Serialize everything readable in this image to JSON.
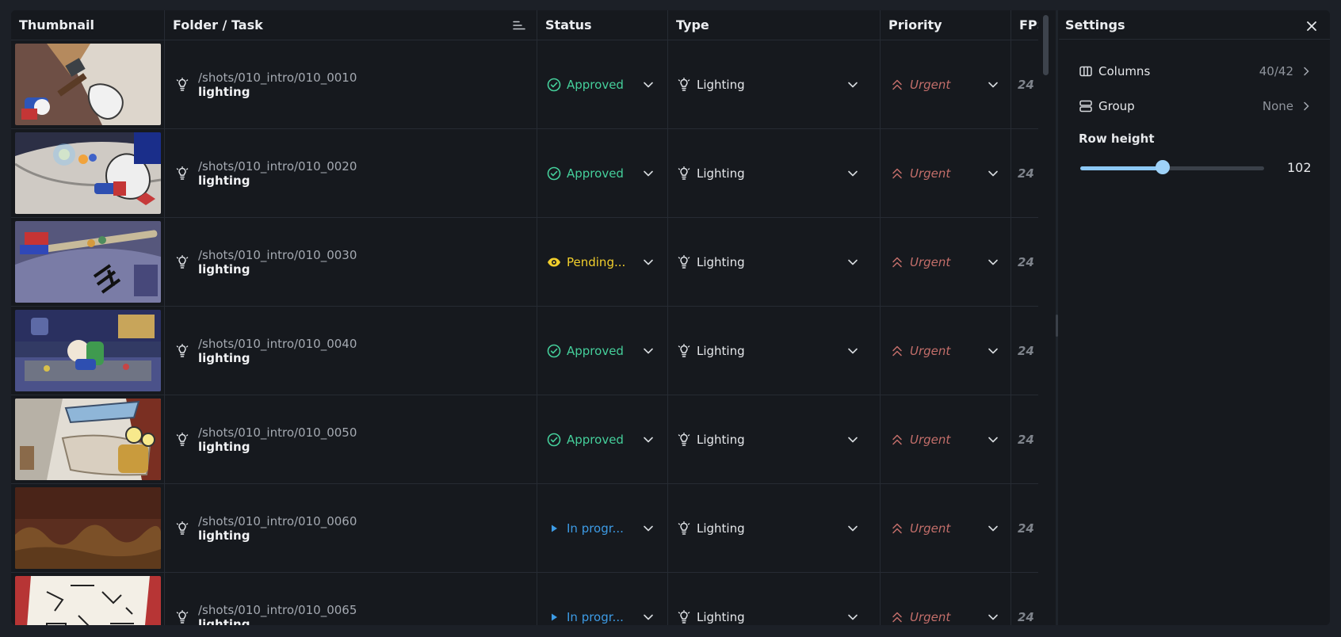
{
  "columns": {
    "thumbnail": "Thumbnail",
    "folder_task": "Folder / Task",
    "status": "Status",
    "type": "Type",
    "priority": "Priority",
    "fps": "FPS"
  },
  "rows": [
    {
      "path": "/shots/010_intro/010_0010",
      "task": "lighting",
      "status": "Approved",
      "status_kind": "approved",
      "type": "Lighting",
      "priority": "Urgent",
      "fps": "24"
    },
    {
      "path": "/shots/010_intro/010_0020",
      "task": "lighting",
      "status": "Approved",
      "status_kind": "approved",
      "type": "Lighting",
      "priority": "Urgent",
      "fps": "24"
    },
    {
      "path": "/shots/010_intro/010_0030",
      "task": "lighting",
      "status": "Pending...",
      "status_kind": "pending",
      "type": "Lighting",
      "priority": "Urgent",
      "fps": "24"
    },
    {
      "path": "/shots/010_intro/010_0040",
      "task": "lighting",
      "status": "Approved",
      "status_kind": "approved",
      "type": "Lighting",
      "priority": "Urgent",
      "fps": "24"
    },
    {
      "path": "/shots/010_intro/010_0050",
      "task": "lighting",
      "status": "Approved",
      "status_kind": "approved",
      "type": "Lighting",
      "priority": "Urgent",
      "fps": "24"
    },
    {
      "path": "/shots/010_intro/010_0060",
      "task": "lighting",
      "status": "In progr...",
      "status_kind": "progress",
      "type": "Lighting",
      "priority": "Urgent",
      "fps": "24"
    },
    {
      "path": "/shots/010_intro/010_0065",
      "task": "lighting",
      "status": "In progr...",
      "status_kind": "progress",
      "type": "Lighting",
      "priority": "Urgent",
      "fps": "24"
    }
  ],
  "colors": {
    "approved": "#45cf9b",
    "pending": "#f2cf2c",
    "progress": "#3d9be5",
    "urgent": "#c36e6a"
  },
  "settings": {
    "title": "Settings",
    "columns_label": "Columns",
    "columns_value": "40/42",
    "group_label": "Group",
    "group_value": "None",
    "row_height_label": "Row height",
    "row_height_value": "102",
    "row_height_fraction": 0.45
  }
}
